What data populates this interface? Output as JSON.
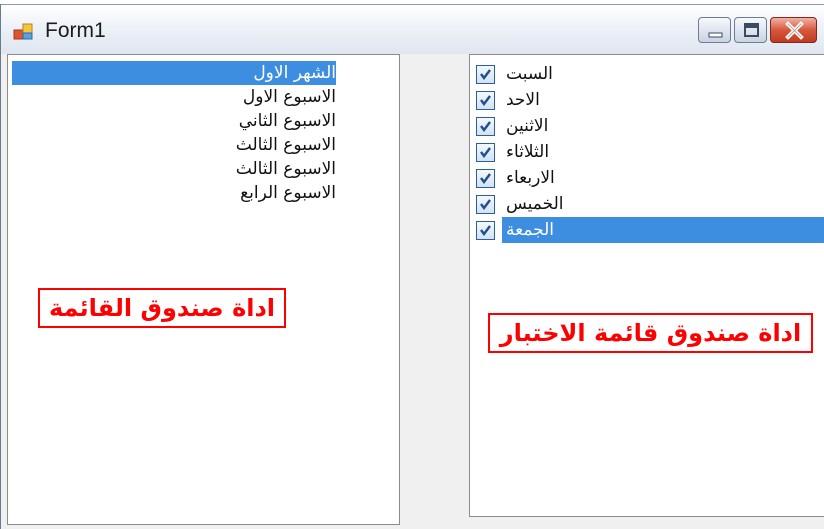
{
  "window": {
    "title": "Form1",
    "icon": "form-app-icon",
    "controls": [
      "minimize-icon",
      "maximize-icon",
      "close-icon"
    ]
  },
  "listbox": {
    "items": [
      {
        "label": "الشهر الاول",
        "selected": true
      },
      {
        "label": "الاسبوع الاول",
        "selected": false
      },
      {
        "label": "الاسبوع الثاني",
        "selected": false
      },
      {
        "label": "الاسبوع الثالث",
        "selected": false
      },
      {
        "label": "الاسبوع الثالث",
        "selected": false
      },
      {
        "label": "الاسبوع الرابع",
        "selected": false
      }
    ],
    "annotation": "اداة صندوق القائمة"
  },
  "checked_listbox": {
    "items": [
      {
        "label": "السبت",
        "checked": true,
        "selected": false
      },
      {
        "label": "الاحد",
        "checked": true,
        "selected": false
      },
      {
        "label": "الاثنين",
        "checked": true,
        "selected": false
      },
      {
        "label": "الثلاثاء",
        "checked": true,
        "selected": false
      },
      {
        "label": "الاربعاء",
        "checked": true,
        "selected": false
      },
      {
        "label": "الخميس",
        "checked": true,
        "selected": false
      },
      {
        "label": "الجمعة",
        "checked": true,
        "selected": true
      }
    ],
    "annotation": "اداة صندوق قائمة الاختبار"
  },
  "colors": {
    "selection": "#3d8ee0",
    "annotation": "#ff0000",
    "checkmark": "#1f4f8f"
  }
}
